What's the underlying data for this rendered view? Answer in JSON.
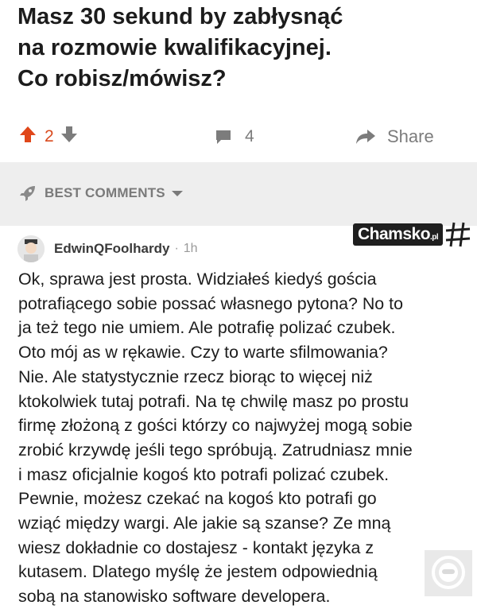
{
  "post": {
    "title_lines": [
      "Masz 30 sekund by zabłysnąć",
      "na rozmowie kwalifikacyjnej.",
      "Co robisz/mówisz?"
    ]
  },
  "actions": {
    "vote_count": "2",
    "comment_count": "4",
    "share_label": "Share"
  },
  "comments_section": {
    "sort_label": "BEST COMMENTS"
  },
  "comment": {
    "username": "EdwinQFoolhardy",
    "separator": "·",
    "age": "1h",
    "body_lines": [
      "Ok, sprawa jest prosta. Widziałeś kiedyś gościa",
      "potrafiącego sobie possać własnego pytona? No to",
      "ja też tego nie umiem. Ale potrafię polizać czubek.",
      "Oto mój as w rękawie. Czy to warte sfilmowania?",
      "Nie. Ale statystycznie rzecz biorąc to więcej niż",
      "ktokolwiek tutaj potrafi. Na tę chwilę masz po prostu",
      "firmę złożoną z gości którzy co najwyżej mogą sobie",
      "zrobić krzywdę jeśli tego spróbują. Zatrudniasz mnie",
      "i masz oficjalnie kogoś kto potrafi polizać czubek.",
      "Pewnie, możesz czekać na kogoś kto potrafi go",
      "wziąć między wargi. Ale jakie są szanse? Ze mną",
      "wiesz dokładnie co dostajesz - kontakt języka z",
      "kutasem. Dlatego myślę że jestem odpowiednią",
      "sobą na stanowisko software developera."
    ]
  },
  "watermark": {
    "text": "Chamsko",
    "suffix": ".pl"
  },
  "icons": {
    "upvote": "arrow-up-icon",
    "downvote": "arrow-down-icon",
    "comments": "comment-bubble-icon",
    "share": "share-arrow-icon",
    "sort": "rocket-icon",
    "sort_caret": "caret-down-icon"
  },
  "colors": {
    "upvote_accent": "#e0471a",
    "section_bg": "#eeeeee",
    "muted_text": "#7c7c7c"
  }
}
